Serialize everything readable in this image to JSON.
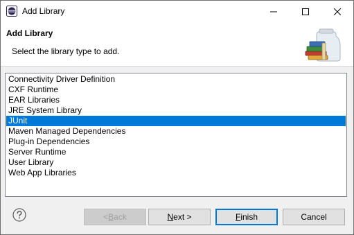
{
  "window": {
    "title": "Add Library"
  },
  "banner": {
    "title": "Add Library",
    "message": "Select the library type to add."
  },
  "library_types": [
    {
      "label": "Connectivity Driver Definition",
      "selected": false
    },
    {
      "label": "CXF Runtime",
      "selected": false
    },
    {
      "label": "EAR Libraries",
      "selected": false
    },
    {
      "label": "JRE System Library",
      "selected": false
    },
    {
      "label": "JUnit",
      "selected": true
    },
    {
      "label": "Maven Managed Dependencies",
      "selected": false
    },
    {
      "label": "Plug-in Dependencies",
      "selected": false
    },
    {
      "label": "Server Runtime",
      "selected": false
    },
    {
      "label": "User Library",
      "selected": false
    },
    {
      "label": "Web App Libraries",
      "selected": false
    }
  ],
  "buttons": {
    "back": {
      "mnemonic": "B",
      "rest": "ack",
      "prefix": "< ",
      "enabled": false
    },
    "next": {
      "mnemonic": "N",
      "rest": "ext >",
      "enabled": true
    },
    "finish": {
      "mnemonic": "F",
      "rest": "inish",
      "enabled": true,
      "default": true
    },
    "cancel": {
      "label": "Cancel",
      "enabled": true
    }
  },
  "icons": {
    "app": "eclipse-icon",
    "help": "help-icon",
    "banner": "library-jar-icon"
  },
  "colors": {
    "selection": "#0078d7",
    "selection_text": "#ffffff"
  }
}
